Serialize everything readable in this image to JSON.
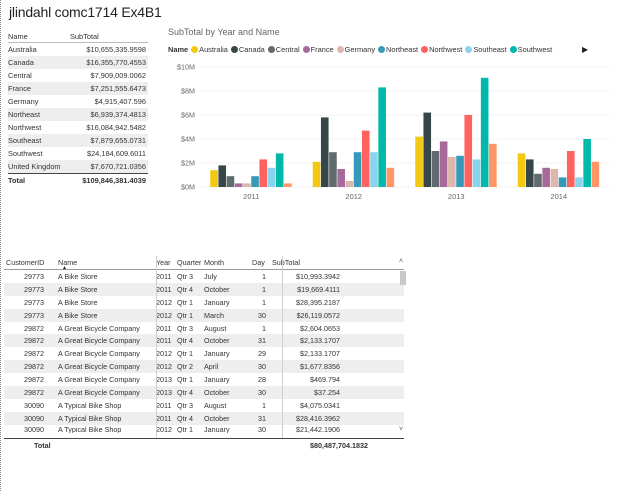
{
  "report": {
    "title": "jlindahl comc1714 Ex4B1"
  },
  "summary_table": {
    "headers": [
      "Name",
      "SubTotal"
    ],
    "rows": [
      [
        "Australia",
        "$10,655,335.9598"
      ],
      [
        "Canada",
        "$16,355,770.4553"
      ],
      [
        "Central",
        "$7,909,009.0062"
      ],
      [
        "France",
        "$7,251,555.6473"
      ],
      [
        "Germany",
        "$4,915,407.596"
      ],
      [
        "Northeast",
        "$6,939,374.4813"
      ],
      [
        "Northwest",
        "$16,084,942.5482"
      ],
      [
        "Southeast",
        "$7,879,655.0731"
      ],
      [
        "Southwest",
        "$24,184,609.6011"
      ],
      [
        "United Kingdom",
        "$7,670,721.0356"
      ]
    ],
    "total_label": "Total",
    "total_value": "$109,846,381.4039"
  },
  "chart": {
    "title": "SubTotal by Year and Name",
    "legend_title": "Name",
    "legend_more_icon": "triangle-right-icon"
  },
  "chart_data": {
    "type": "bar",
    "title": "SubTotal by Year and Name",
    "xlabel": "",
    "ylabel": "",
    "categories": [
      "2011",
      "2012",
      "2013",
      "2014"
    ],
    "ylim": [
      0,
      10
    ],
    "y_ticks": [
      "$0M",
      "$2M",
      "$4M",
      "$6M",
      "$8M",
      "$10M"
    ],
    "grid": true,
    "legend_position": "top",
    "series": [
      {
        "name": "Australia",
        "color": "#F2C811",
        "values": [
          1.4,
          2.1,
          4.2,
          2.8
        ]
      },
      {
        "name": "Canada",
        "color": "#374649",
        "values": [
          1.8,
          5.8,
          6.2,
          2.3
        ]
      },
      {
        "name": "Central",
        "color": "#5F6B6D",
        "values": [
          0.9,
          2.9,
          3.0,
          1.1
        ]
      },
      {
        "name": "France",
        "color": "#A66999",
        "values": [
          0.3,
          1.5,
          3.8,
          1.6
        ]
      },
      {
        "name": "Germany",
        "color": "#DDB6AE",
        "values": [
          0.3,
          0.5,
          2.5,
          1.5
        ]
      },
      {
        "name": "Northeast",
        "color": "#3599B8",
        "values": [
          0.9,
          2.9,
          2.6,
          0.8
        ]
      },
      {
        "name": "Northwest",
        "color": "#FD625E",
        "values": [
          2.3,
          4.7,
          6.0,
          3.0
        ]
      },
      {
        "name": "Southeast",
        "color": "#8AD4EB",
        "values": [
          1.6,
          2.9,
          2.3,
          0.8
        ]
      },
      {
        "name": "Southwest",
        "color": "#01B8AA",
        "values": [
          2.8,
          8.3,
          9.1,
          4.0
        ]
      },
      {
        "name": "United Kingdom",
        "color": "#FE9666",
        "values": [
          0.3,
          1.6,
          3.6,
          2.1
        ]
      }
    ]
  },
  "detail_table": {
    "headers": [
      "CustomerID",
      "Name",
      "Year",
      "Quarter",
      "Month",
      "Day",
      "SubTotal"
    ],
    "rows": [
      [
        "29773",
        "A Bike Store",
        "2011",
        "Qtr 3",
        "July",
        "1",
        "$10,993.3942"
      ],
      [
        "29773",
        "A Bike Store",
        "2011",
        "Qtr 4",
        "October",
        "1",
        "$19,669.4111"
      ],
      [
        "29773",
        "A Bike Store",
        "2012",
        "Qtr 1",
        "January",
        "1",
        "$28,395.2187"
      ],
      [
        "29773",
        "A Bike Store",
        "2012",
        "Qtr 1",
        "March",
        "30",
        "$26,119.0572"
      ],
      [
        "29872",
        "A Great Bicycle Company",
        "2011",
        "Qtr 3",
        "August",
        "1",
        "$2,604.0653"
      ],
      [
        "29872",
        "A Great Bicycle Company",
        "2011",
        "Qtr 4",
        "October",
        "31",
        "$2,133.1707"
      ],
      [
        "29872",
        "A Great Bicycle Company",
        "2012",
        "Qtr 1",
        "January",
        "29",
        "$2,133.1707"
      ],
      [
        "29872",
        "A Great Bicycle Company",
        "2012",
        "Qtr 2",
        "April",
        "30",
        "$1,677.8356"
      ],
      [
        "29872",
        "A Great Bicycle Company",
        "2013",
        "Qtr 1",
        "January",
        "28",
        "$469.794"
      ],
      [
        "29872",
        "A Great Bicycle Company",
        "2013",
        "Qtr 4",
        "October",
        "30",
        "$37.254"
      ],
      [
        "30090",
        "A Typical Bike Shop",
        "2011",
        "Qtr 3",
        "August",
        "1",
        "$4,075.0341"
      ],
      [
        "30090",
        "A Typical Bike Shop",
        "2011",
        "Qtr 4",
        "October",
        "31",
        "$28,416.3962"
      ],
      [
        "30090",
        "A Typical Bike Shop",
        "2012",
        "Qtr 1",
        "January",
        "30",
        "$21,442.1906"
      ]
    ],
    "total_label": "Total",
    "total_value": "$80,487,704.1832",
    "sort_icon": "sort-ascending-icon",
    "scroll_up_icon": "chevron-up-icon",
    "scroll_down_icon": "chevron-down-icon"
  }
}
